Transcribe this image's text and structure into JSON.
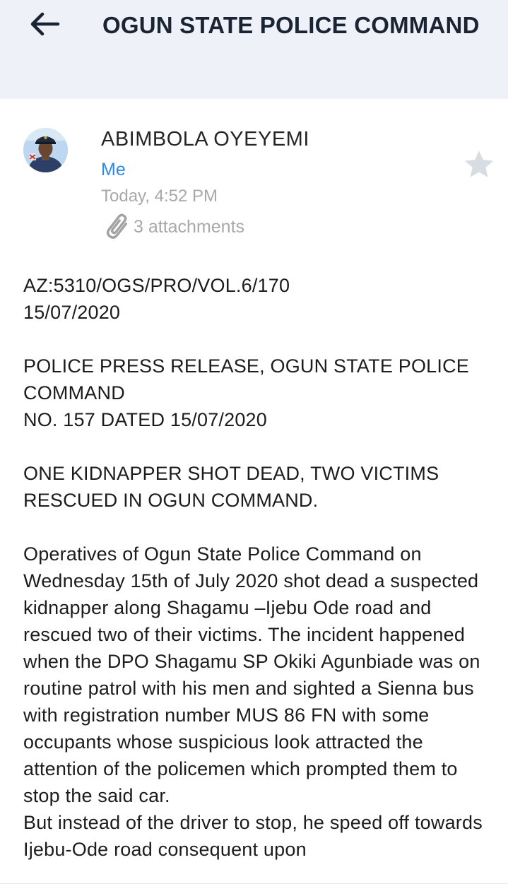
{
  "header": {
    "title": "OGUN STATE POLICE COMMAND",
    "back_icon": "arrow-left-icon"
  },
  "message": {
    "sender": "ABIMBOLA OYEYEMI",
    "recipient": "Me",
    "date": "Today, 4:52 PM",
    "attachments_label": "3 attachments",
    "attachment_icon": "paperclip-icon",
    "star_icon": "star-icon",
    "starred": false
  },
  "body": {
    "ref": "AZ:5310/OGS/PRO/VOL.6/170\n15/07/2020",
    "release": "POLICE PRESS RELEASE, OGUN STATE POLICE COMMAND\nNO. 157 DATED 15/07/2020",
    "headline": "ONE KIDNAPPER SHOT DEAD, TWO VICTIMS RESCUED IN OGUN COMMAND.",
    "paragraph": "Operatives of Ogun State Police Command on Wednesday 15th of July 2020 shot dead a suspected kidnapper along Shagamu –Ijebu Ode road and rescued two of their victims. The incident happened when the DPO Shagamu SP Okiki Agunbiade was on routine patrol with his men and sighted a Sienna bus with registration number MUS 86 FN with some occupants whose suspicious look attracted the attention of the policemen which prompted them to stop the said car.\nBut instead of the driver to stop, he speed off towards Ijebu-Ode road consequent upon"
  },
  "colors": {
    "header_bg": "#eff1f8",
    "accent": "#2c8ae8",
    "muted": "#a8a8a8",
    "star": "#d8dde3"
  }
}
